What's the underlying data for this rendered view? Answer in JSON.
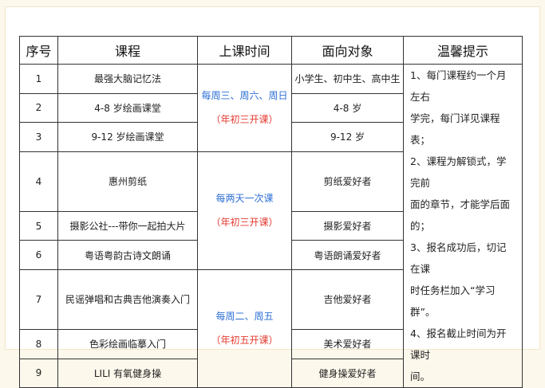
{
  "table": {
    "headers": [
      "序号",
      "课程",
      "上课时间",
      "面向对象",
      "温馨提示"
    ],
    "rows": [
      {
        "no": "1",
        "course": "最强大脑记忆法",
        "audience": "小学生、初中生、高中生"
      },
      {
        "no": "2",
        "course": "4-8 岁绘画课堂",
        "audience": "4-8 岁"
      },
      {
        "no": "3",
        "course": "9-12 岁绘画课堂",
        "audience": "9-12 岁"
      },
      {
        "no": "4",
        "course": "惠州剪纸",
        "audience": "剪纸爱好者"
      },
      {
        "no": "5",
        "course": "摄影公社---带你一起拍大片",
        "audience": "摄影爱好者"
      },
      {
        "no": "6",
        "course": "粤语粤韵古诗文朗诵",
        "audience": "粤语朗诵爱好者"
      },
      {
        "no": "7",
        "course": "民谣弹唱和古典吉他演奏入门",
        "audience": "吉他爱好者"
      },
      {
        "no": "8",
        "course": "色彩绘画临摹入门",
        "audience": "美术爱好者"
      },
      {
        "no": "9",
        "course": "LILI 有氧健身操",
        "audience": "健身操爱好者"
      }
    ],
    "schedule_groups": [
      {
        "time": "每周三、周六、周日",
        "note": "（年初三开课）"
      },
      {
        "time": "每两天一次课",
        "note": "（年初三开课）"
      },
      {
        "time": "每周二、周五",
        "note": "（年初五开课）"
      }
    ],
    "tips": [
      "1、每门课程约一个月左右",
      "学完，每门详见课程表；",
      "2、课程为解锁式，学完前",
      "面的章节，才能学后面的；",
      "3、报名成功后，切记在课",
      "时任务栏加入“学习群”。",
      "4、报名截止时间为开课时",
      "间。"
    ]
  }
}
